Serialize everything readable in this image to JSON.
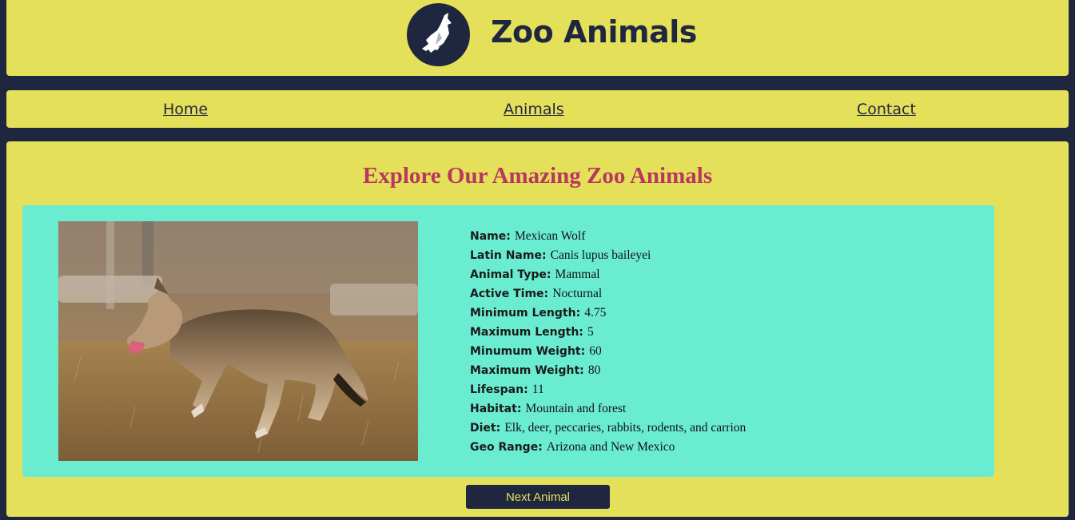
{
  "header": {
    "title": "Zoo Animals",
    "logo_icon": "bird-icon"
  },
  "nav": {
    "home": "Home",
    "animals": "Animals",
    "contact": "Contact"
  },
  "main": {
    "heading": "Explore Our Amazing Zoo Animals",
    "photo": "mexican-wolf-photo",
    "next_button": "Next Animal"
  },
  "animal": {
    "name": {
      "label": "Name:",
      "value": " Mexican Wolf"
    },
    "latin": {
      "label": "Latin Name:",
      "value": " Canis lupus baileyei"
    },
    "type": {
      "label": "Animal Type:",
      "value": "Mammal"
    },
    "active": {
      "label": "Active Time:",
      "value": "Nocturnal"
    },
    "min_length": {
      "label": "Minimum Length:",
      "value": "4.75"
    },
    "max_length": {
      "label": "Maximum Length:",
      "value": "5"
    },
    "min_weight": {
      "label": "Minumum Weight:",
      "value": "60"
    },
    "max_weight": {
      "label": "Maximum Weight:",
      "value": "80"
    },
    "lifespan": {
      "label": "Lifespan:",
      "value": "11"
    },
    "habitat": {
      "label": "Habitat:",
      "value": "Mountain and forest"
    },
    "diet": {
      "label": "Diet:",
      "value": "Elk, deer, peccaries, rabbits, rodents, and carrion"
    },
    "geo_range": {
      "label": "Geo Range:",
      "value": "Arizona and New Mexico"
    }
  },
  "colors": {
    "background": "#1f2740",
    "panel": "#e5e059",
    "card": "#6aecd1",
    "heading": "#b8375f"
  }
}
